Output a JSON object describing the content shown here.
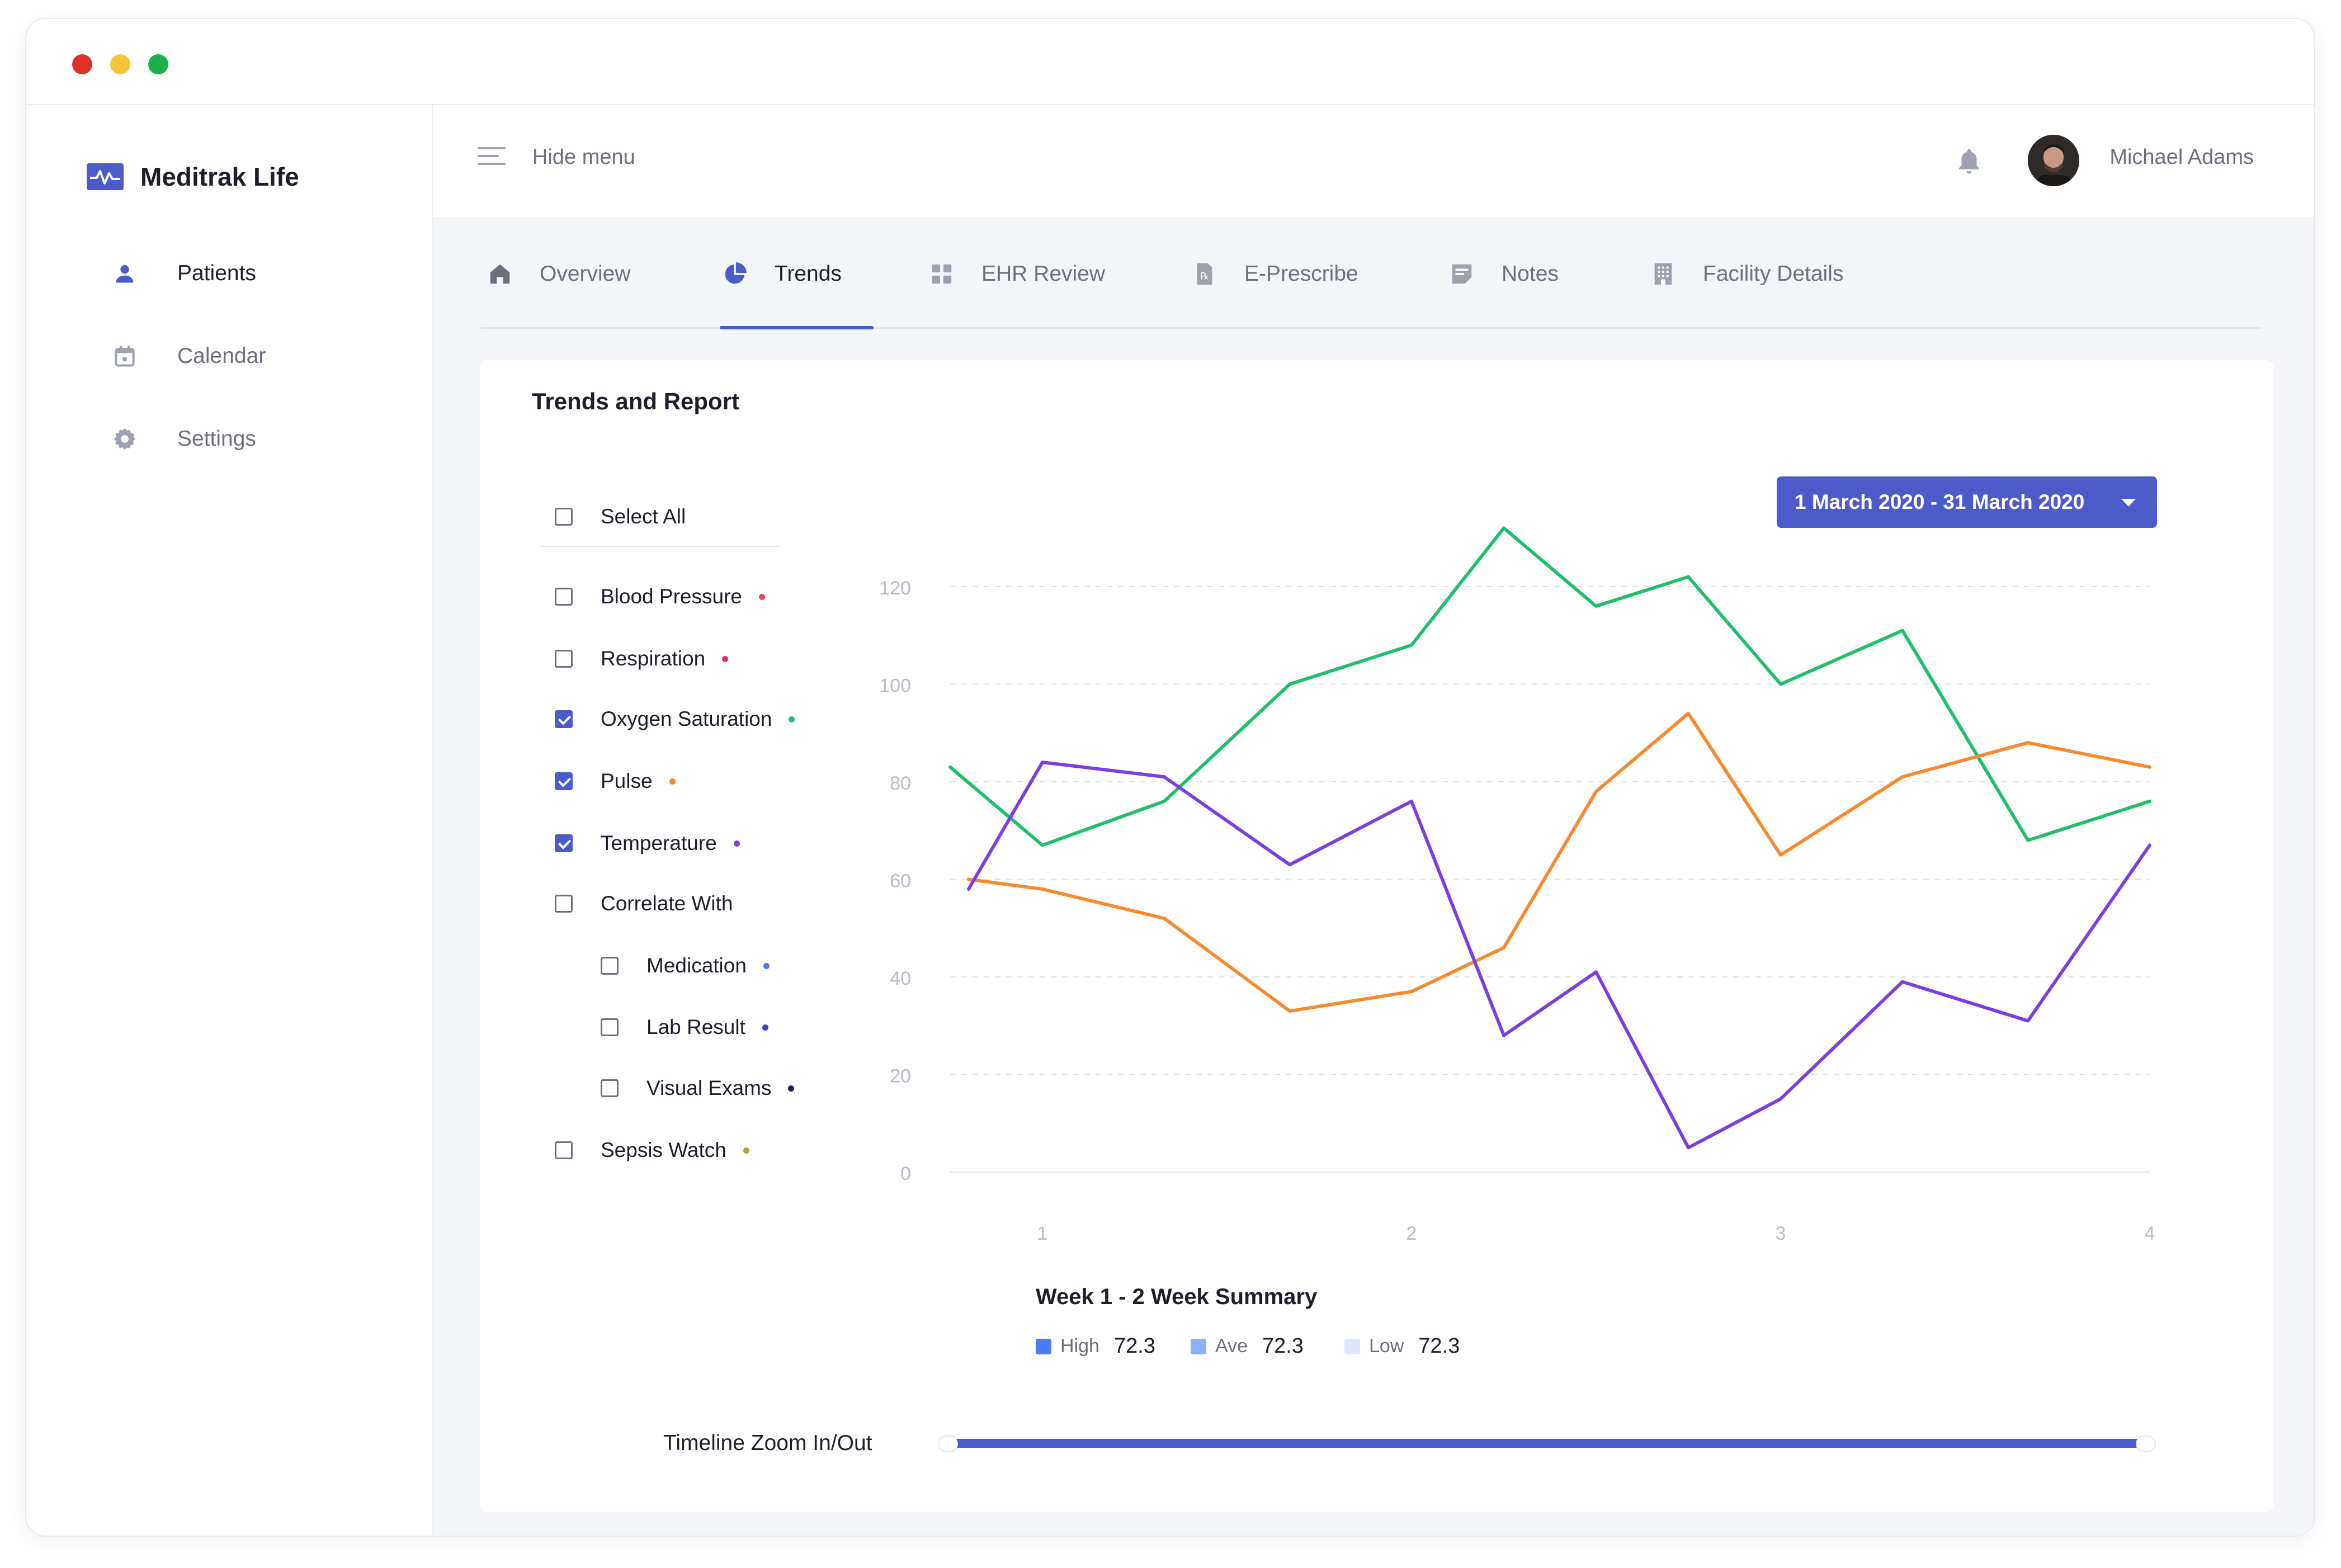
{
  "app": {
    "name": "Meditrak Life"
  },
  "colors": {
    "accent": "#4b5bc9",
    "window_red": "#e0302b",
    "window_yellow": "#f5c43b",
    "window_green": "#1cb04a"
  },
  "sidebar": {
    "items": [
      {
        "label": "Patients",
        "icon": "person-icon",
        "active": true
      },
      {
        "label": "Calendar",
        "icon": "calendar-icon",
        "active": false
      },
      {
        "label": "Settings",
        "icon": "gear-icon",
        "active": false
      }
    ]
  },
  "topbar": {
    "hide_menu": "Hide menu",
    "user_name": "Michael Adams"
  },
  "tabs": [
    {
      "label": "Overview",
      "icon": "home-icon"
    },
    {
      "label": "Trends",
      "icon": "pie-chart-icon",
      "active": true
    },
    {
      "label": "EHR Review",
      "icon": "grid-icon"
    },
    {
      "label": "E-Prescribe",
      "icon": "prescription-icon"
    },
    {
      "label": "Notes",
      "icon": "note-icon"
    },
    {
      "label": "Facility Details",
      "icon": "building-icon"
    }
  ],
  "report": {
    "title": "Trends and Report",
    "date_range": "1 March 2020 - 31 March 2020",
    "filters": {
      "select_all": "Select All",
      "items": [
        {
          "label": "Blood Pressure",
          "checked": false,
          "dot": "#f04452"
        },
        {
          "label": "Respiration",
          "checked": false,
          "dot": "#e8265e"
        },
        {
          "label": "Oxygen Saturation",
          "checked": true,
          "dot": "#1fbf6c"
        },
        {
          "label": "Pulse",
          "checked": true,
          "dot": "#f58a2e"
        },
        {
          "label": "Temperature",
          "checked": true,
          "dot": "#7b3fe0"
        },
        {
          "label": "Correlate With",
          "checked": false,
          "dot": null
        },
        {
          "label": "Medication",
          "checked": false,
          "dot": "#5e72e4",
          "indent": true
        },
        {
          "label": "Lab Result",
          "checked": false,
          "dot": "#3744b8",
          "indent": true
        },
        {
          "label": "Visual Exams",
          "checked": false,
          "dot": "#1d1e5c",
          "indent": true
        },
        {
          "label": "Sepsis Watch",
          "checked": false,
          "dot": "#b59a2a"
        }
      ]
    },
    "summary": {
      "title": "Week 1 - 2 Week  Summary",
      "items": [
        {
          "label": "High",
          "value": "72.3",
          "color": "#4b7bf5"
        },
        {
          "label": "Ave",
          "value": "72.3",
          "color": "#8fb0f7"
        },
        {
          "label": "Low",
          "value": "72.3",
          "color": "#dde6fb"
        }
      ]
    },
    "zoom_label": "Timeline Zoom In/Out",
    "zoom_range": [
      0,
      1
    ]
  },
  "chart_data": {
    "type": "line",
    "xlim": [
      0.75,
      4
    ],
    "ylim": [
      0,
      120
    ],
    "x_ticks": [
      1,
      2,
      3,
      4
    ],
    "y_ticks": [
      0,
      20,
      40,
      60,
      80,
      100,
      120
    ],
    "grid": true,
    "series": [
      {
        "color": "#1fbf6c",
        "x": [
          0.75,
          1.0,
          1.33,
          1.67,
          2.0,
          2.25,
          2.5,
          2.75,
          3.0,
          3.33,
          3.67,
          4.0
        ],
        "y": [
          83,
          67,
          76,
          100,
          108,
          132,
          116,
          122,
          100,
          111,
          68,
          76
        ]
      },
      {
        "color": "#f58a2e",
        "x": [
          0.8,
          1.0,
          1.33,
          1.67,
          2.0,
          2.25,
          2.5,
          2.75,
          3.0,
          3.33,
          3.67,
          4.0
        ],
        "y": [
          60,
          58,
          52,
          33,
          37,
          46,
          78,
          94,
          65,
          81,
          88,
          83
        ]
      },
      {
        "color": "#7b3fe0",
        "x": [
          0.8,
          1.0,
          1.33,
          1.67,
          2.0,
          2.25,
          2.5,
          2.75,
          3.0,
          3.33,
          3.67,
          4.0
        ],
        "y": [
          58,
          84,
          81,
          63,
          76,
          28,
          41,
          5,
          15,
          39,
          31,
          67
        ]
      }
    ]
  }
}
